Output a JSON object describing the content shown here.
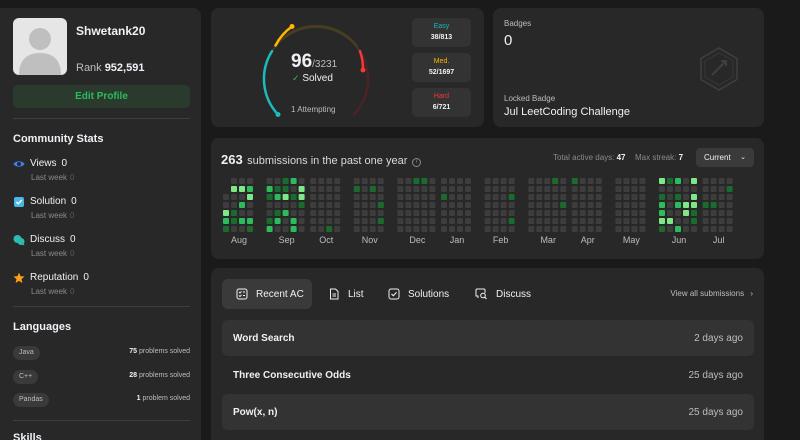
{
  "profile": {
    "username": "Shwetank20",
    "rank_label": "Rank",
    "rank_value": "952,591",
    "edit_label": "Edit Profile"
  },
  "community": {
    "title": "Community Stats",
    "items": [
      {
        "label": "Views",
        "value": "0",
        "sub_label": "Last week",
        "sub_value": "0",
        "icon": "eye-icon",
        "color": "#3b82f6"
      },
      {
        "label": "Solution",
        "value": "0",
        "sub_label": "Last week",
        "sub_value": "0",
        "icon": "check-square-icon",
        "color": "#48b6e8"
      },
      {
        "label": "Discuss",
        "value": "0",
        "sub_label": "Last week",
        "sub_value": "0",
        "icon": "chat-icon",
        "color": "#2cbbb0"
      },
      {
        "label": "Reputation",
        "value": "0",
        "sub_label": "Last week",
        "sub_value": "0",
        "icon": "star-icon",
        "color": "#ffa116"
      }
    ]
  },
  "languages": {
    "title": "Languages",
    "items": [
      {
        "name": "Java",
        "count": "75",
        "suffix": "problems solved"
      },
      {
        "name": "C++",
        "count": "28",
        "suffix": "problems solved"
      },
      {
        "name": "Pandas",
        "count": "1",
        "suffix": "problem solved"
      }
    ]
  },
  "skills_title": "Skills",
  "solved": {
    "count": "96",
    "total": "/3231",
    "label": "Solved",
    "attempting": "1 Attempting",
    "easy": {
      "label": "Easy",
      "value": "38/813",
      "color": "#1cbaba"
    },
    "medium": {
      "label": "Med.",
      "value": "52/1697",
      "color": "#ffb700"
    },
    "hard": {
      "label": "Hard",
      "value": "6/721",
      "color": "#f63737"
    }
  },
  "badges": {
    "label": "Badges",
    "count": "0",
    "locked_label": "Locked Badge",
    "locked_name": "Jul LeetCoding Challenge"
  },
  "submissions": {
    "count": "263",
    "text": "submissions in the past one year",
    "active_label": "Total active days:",
    "active_value": "47",
    "streak_label": "Max streak:",
    "streak_value": "7",
    "dropdown": "Current",
    "months": [
      "Aug",
      "Sep",
      "Oct",
      "Nov",
      "Dec",
      "Jan",
      "Feb",
      "Mar",
      "Apr",
      "May",
      "Jun",
      "Jul"
    ]
  },
  "recent": {
    "tabs": [
      "Recent AC",
      "List",
      "Solutions",
      "Discuss"
    ],
    "view_all": "View all submissions",
    "rows": [
      {
        "title": "Word Search",
        "date": "2 days ago"
      },
      {
        "title": "Three Consecutive Odds",
        "date": "25 days ago"
      },
      {
        "title": "Pow(x, n)",
        "date": "25 days ago"
      }
    ]
  }
}
